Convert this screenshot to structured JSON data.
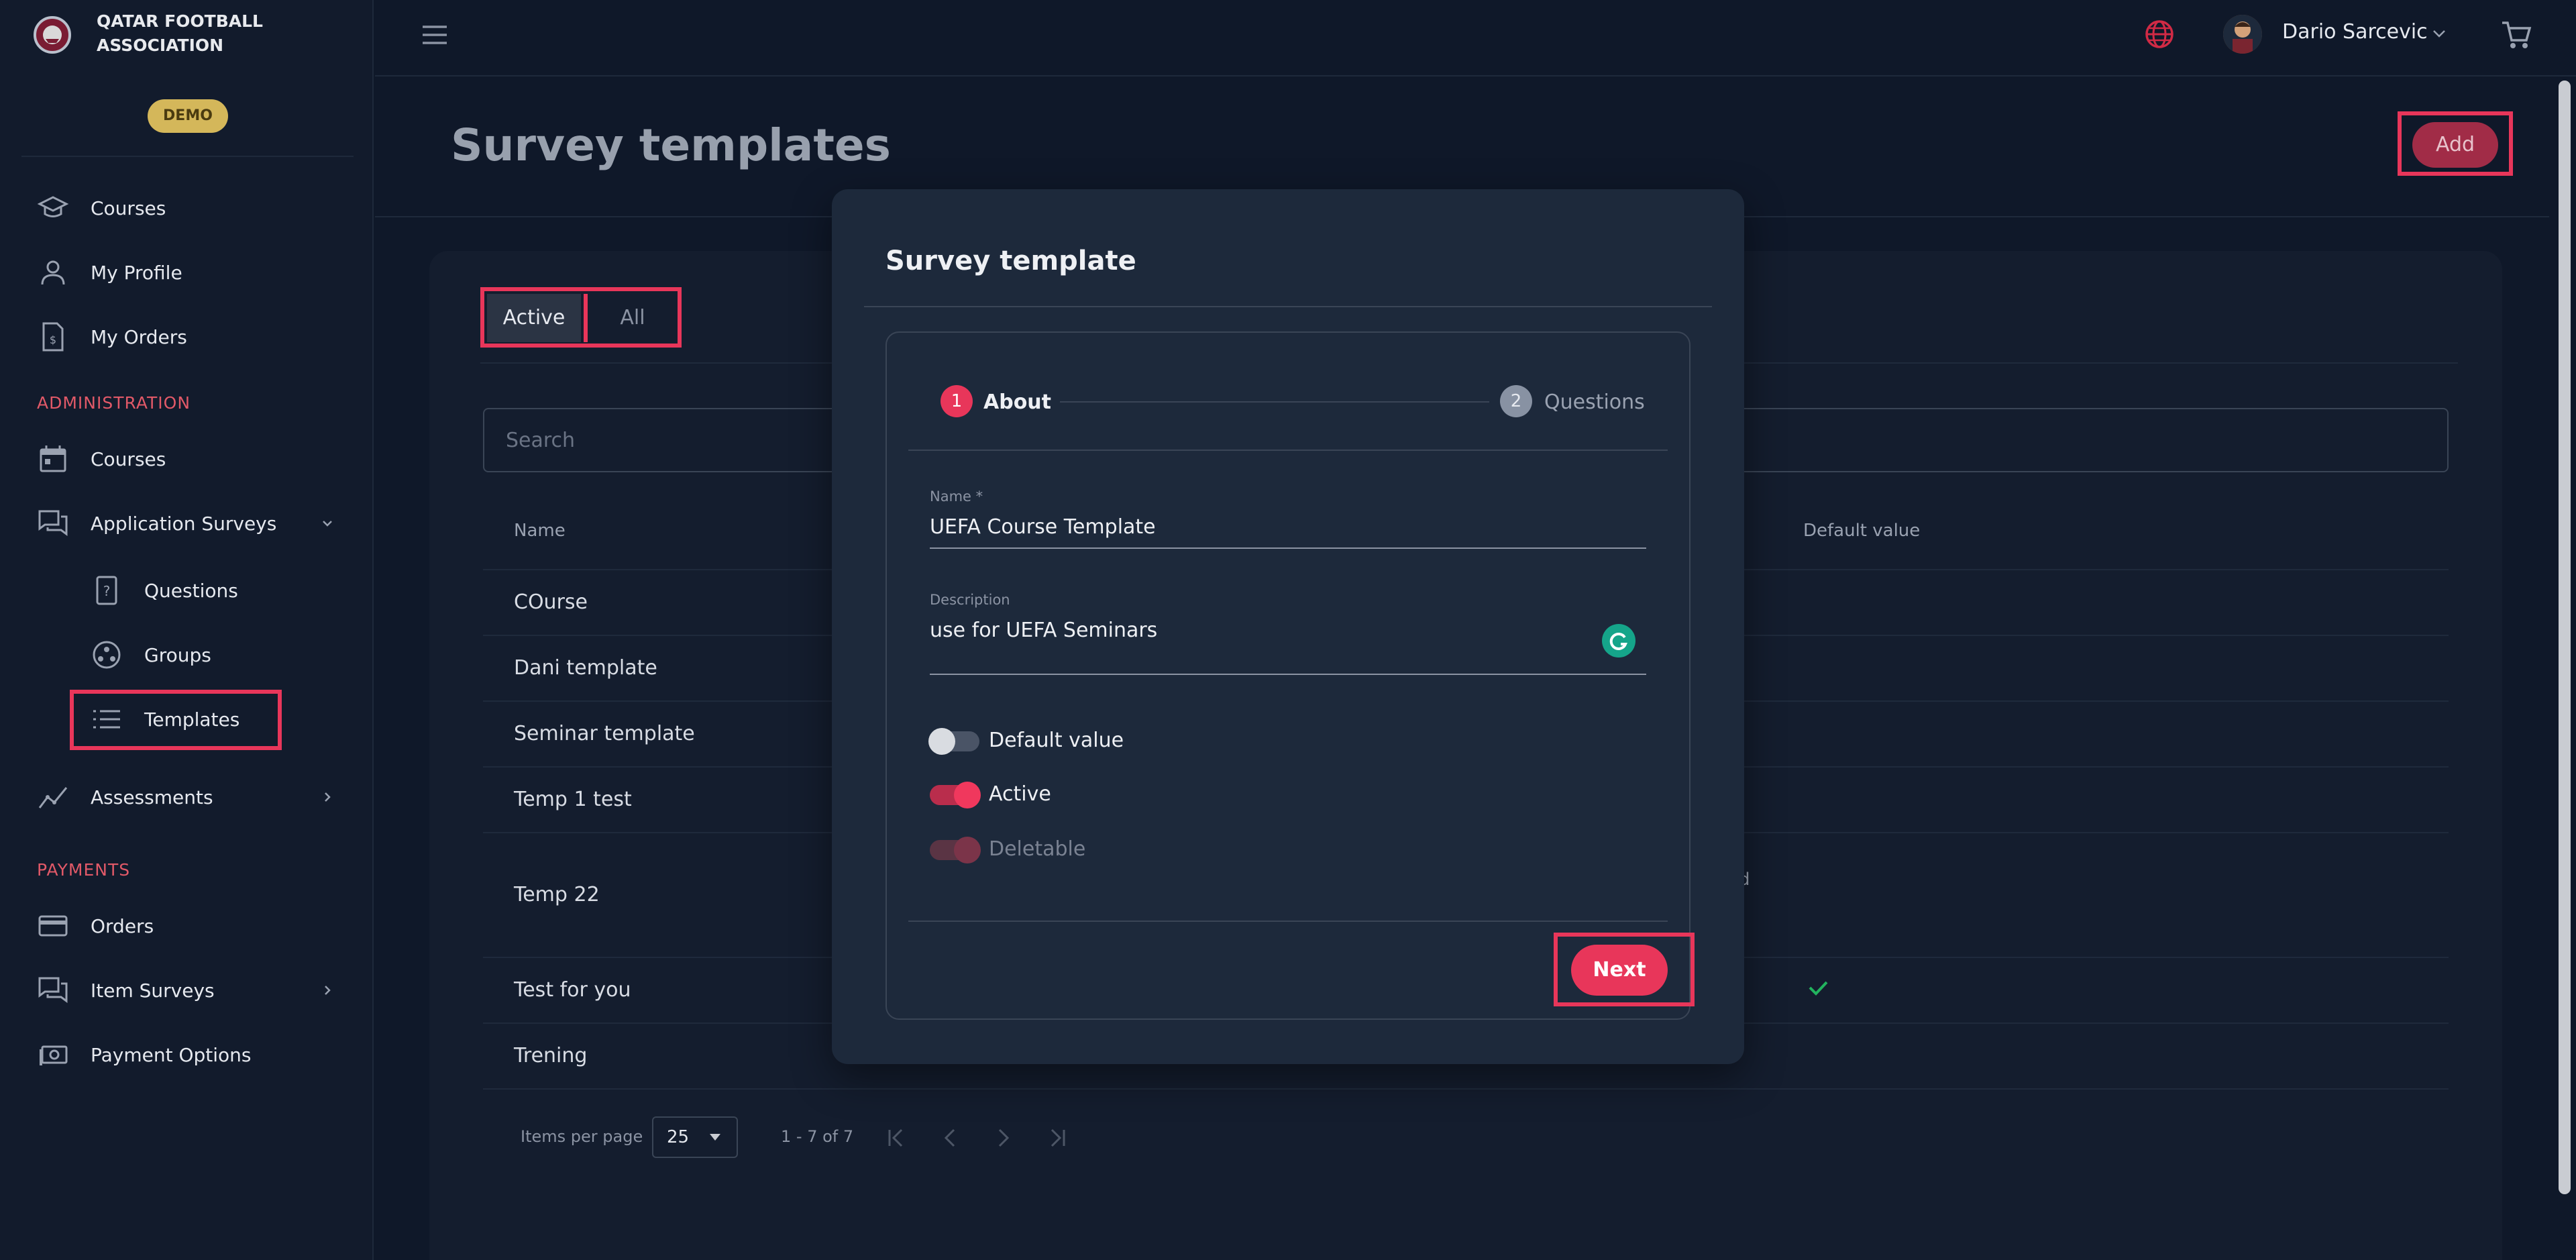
{
  "brand": {
    "line1": "QATAR FOOTBALL",
    "line2": "ASSOCIATION",
    "badge": "DEMO"
  },
  "sidebar": {
    "items_top": [
      {
        "label": "Courses",
        "icon": "graduation-cap-icon"
      },
      {
        "label": "My Profile",
        "icon": "person-icon"
      },
      {
        "label": "My Orders",
        "icon": "invoice-icon"
      }
    ],
    "section_admin": "ADMINISTRATION",
    "admin_items": [
      {
        "label": "Courses",
        "icon": "calendar-icon"
      },
      {
        "label": "Application Surveys",
        "icon": "chat-icon"
      },
      {
        "label": "Questions",
        "icon": "question-icon"
      },
      {
        "label": "Groups",
        "icon": "groups-icon"
      },
      {
        "label": "Templates",
        "icon": "list-icon"
      },
      {
        "label": "Assessments",
        "icon": "chart-line-icon"
      }
    ],
    "section_payments": "PAYMENTS",
    "payment_items": [
      {
        "label": "Orders",
        "icon": "credit-card-icon"
      },
      {
        "label": "Item Surveys",
        "icon": "chat-icon"
      },
      {
        "label": "Payment Options",
        "icon": "money-icon"
      }
    ]
  },
  "topbar": {
    "user_name": "Dario Sarcevic"
  },
  "page": {
    "title": "Survey templates",
    "add_label": "Add"
  },
  "tabs": {
    "active": "Active",
    "all": "All"
  },
  "search": {
    "placeholder": "Search"
  },
  "table": {
    "col_name": "Name",
    "col_default": "Default value",
    "rows": [
      {
        "name": "COurse"
      },
      {
        "name": "Dani template"
      },
      {
        "name": "Seminar template"
      },
      {
        "name": "Temp 1 test"
      },
      {
        "name": "Temp 22",
        "partial": "d"
      },
      {
        "name": "Test for you",
        "default": true
      },
      {
        "name": "Trening"
      }
    ]
  },
  "pager": {
    "label": "Items per page",
    "value": "25",
    "range": "1 - 7 of 7"
  },
  "modal": {
    "title": "Survey template",
    "step1": "1",
    "step1_label": "About",
    "step2": "2",
    "step2_label": "Questions",
    "name_label": "Name *",
    "name_value": "UEFA Course Template",
    "desc_label": "Description",
    "desc_value": "use for UEFA Seminars",
    "toggles": [
      {
        "label": "Default value",
        "on": false,
        "disabled": false
      },
      {
        "label": "Active",
        "on": true,
        "disabled": false
      },
      {
        "label": "Deletable",
        "on": true,
        "disabled": true
      }
    ],
    "next_label": "Next"
  },
  "colors": {
    "accent": "#e8365a",
    "background": "#0f1829",
    "sidebar": "#121b2c",
    "modal": "#1d293b",
    "badge": "#d4b75a",
    "section": "#e15968"
  }
}
